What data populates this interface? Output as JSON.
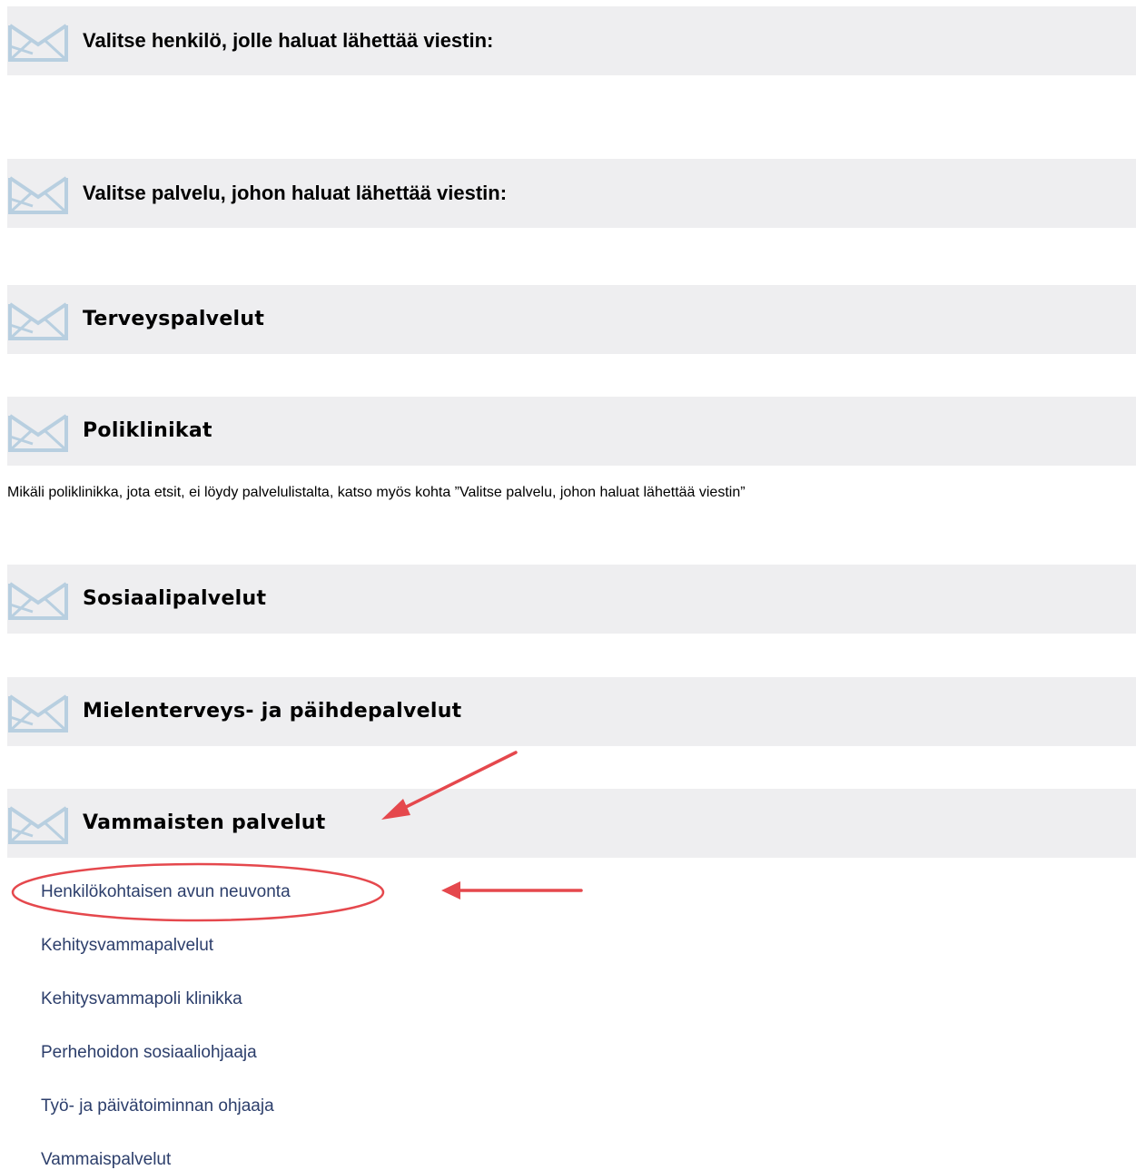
{
  "sections": {
    "select_person": {
      "title": "Valitse henkilö, jolle haluat lähettää viestin:"
    },
    "select_service": {
      "title": "Valitse palvelu, johon haluat lähettää viestin:"
    },
    "health": {
      "title": "Terveyspalvelut"
    },
    "clinics": {
      "title": "Poliklinikat",
      "note": "Mikäli poliklinikka, jota etsit, ei löydy palvelulistalta, katso myös kohta ”Valitse palvelu, johon haluat lähettää viestin”"
    },
    "social": {
      "title": "Sosiaalipalvelut"
    },
    "mental": {
      "title": "Mielenterveys- ja päihdepalvelut"
    },
    "disability": {
      "title": "Vammaisten palvelut",
      "items": [
        "Henkilökohtaisen avun neuvonta",
        "Kehitysvammapalvelut",
        "Kehitysvammapoli klinikka",
        "Perhehoidon sosiaaliohjaaja",
        "Työ- ja päivätoiminnan ohjaaja",
        "Vammaispalvelut"
      ]
    }
  },
  "icons": {
    "section": "envelope-icon"
  },
  "colors": {
    "bar_background": "#eeeef0",
    "envelope": "#b8cfe0",
    "link": "#2c3e6b",
    "annotation": "#e5484d"
  }
}
